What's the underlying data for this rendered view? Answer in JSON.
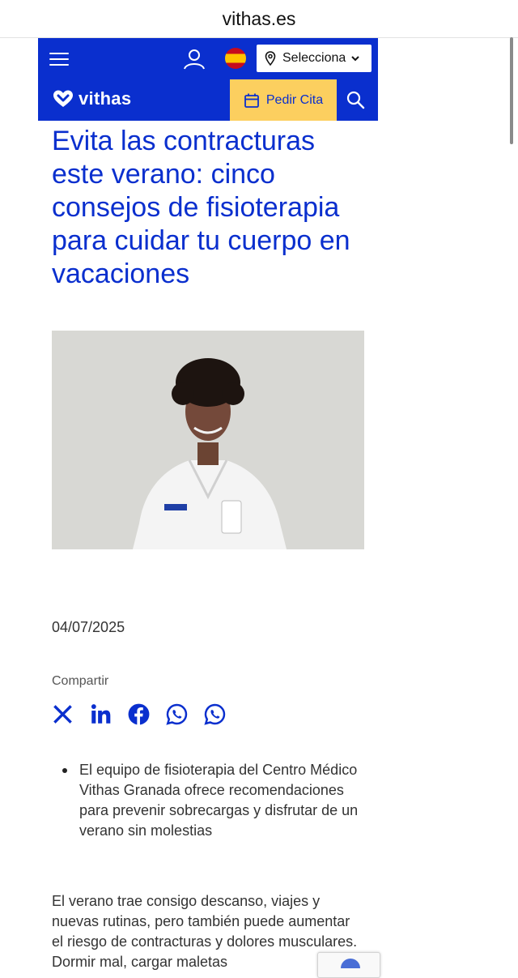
{
  "browser": {
    "url": "vithas.es"
  },
  "header": {
    "location_select": {
      "selected": "Selecciona"
    },
    "logo_text": "vithas",
    "cta_label": "Pedir Cita",
    "accent_color": "#0a2fce",
    "cta_color": "#fccf5f"
  },
  "article": {
    "title": "Evita las contracturas este verano: cinco consejos de fisioterapia para cuidar tu cuerpo en vacaciones",
    "date": "04/07/2025",
    "share_label": "Compartir",
    "share_icons": [
      "x-icon",
      "linkedin-icon",
      "facebook-icon",
      "whatsapp-icon",
      "whatsapp-icon"
    ],
    "bullets": [
      "El equipo de fisioterapia del Centro Médico Vithas Granada ofrece recomendaciones para prevenir sobrecargas y disfrutar de un verano sin molestias"
    ],
    "intro": "El verano trae consigo descanso, viajes y nuevas rutinas, pero también puede aumentar el riesgo de contracturas y dolores musculares. Dormir mal, cargar maletas"
  }
}
